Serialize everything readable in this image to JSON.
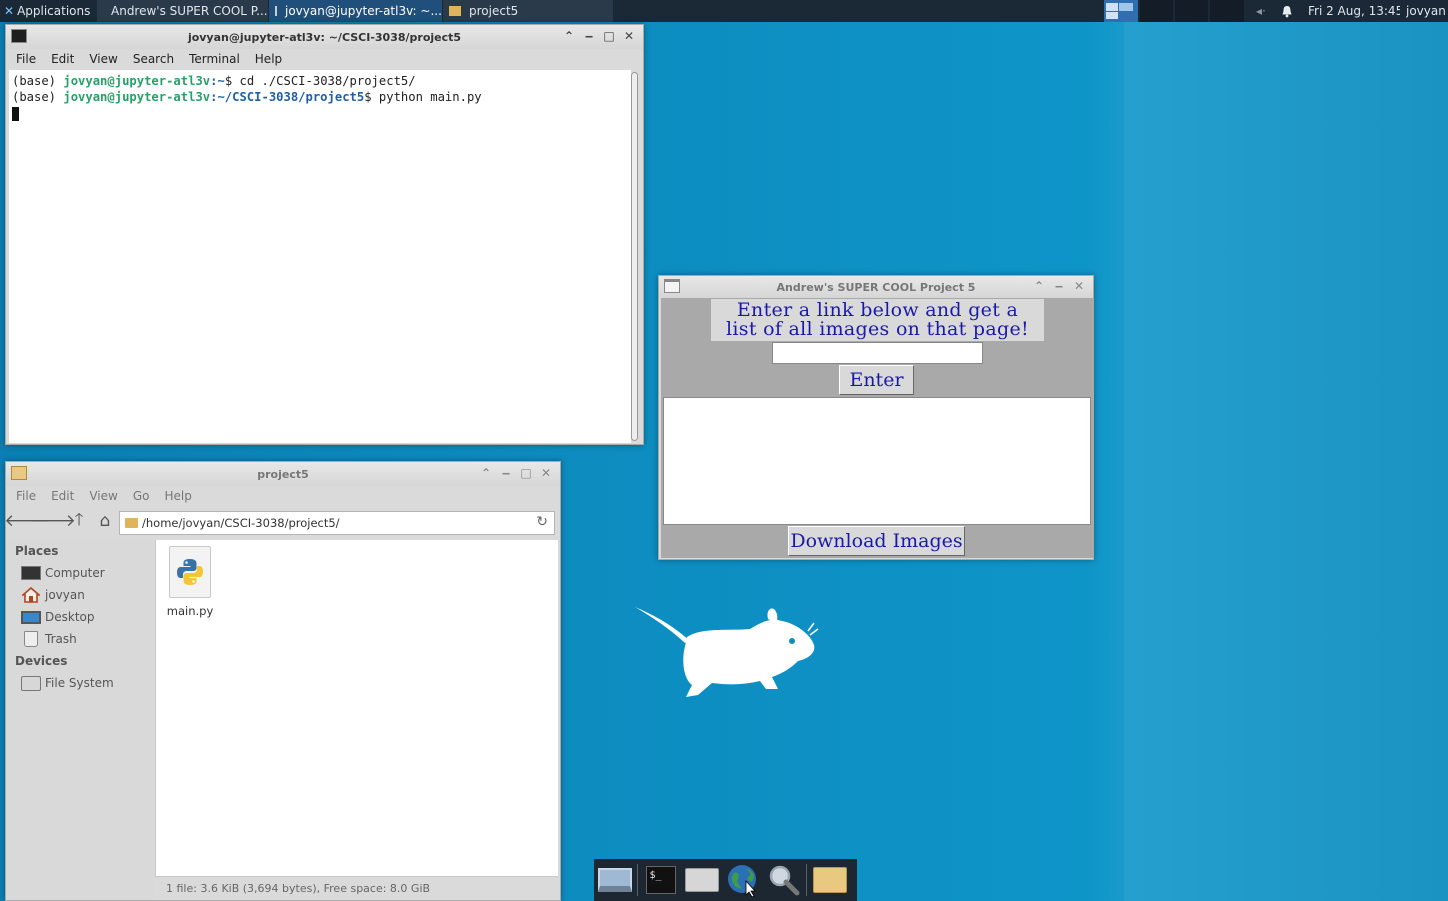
{
  "panel": {
    "apps_label": "Applications",
    "tasks": [
      {
        "label": "Andrew's SUPER COOL P...",
        "icon": "window-icon"
      },
      {
        "label": "jovyan@jupyter-atl3v: ~...",
        "icon": "terminal-icon"
      },
      {
        "label": "project5",
        "icon": "folder-icon"
      }
    ],
    "clock": "Fri  2 Aug, 13:45",
    "user": "jovyan"
  },
  "terminal": {
    "title": "jovyan@jupyter-atl3v: ~/CSCI-3038/project5",
    "menu": [
      "File",
      "Edit",
      "View",
      "Search",
      "Terminal",
      "Help"
    ],
    "lines": [
      {
        "prefix": "(base) ",
        "user": "jovyan@jupyter-atl3v",
        "path": ":~",
        "cmd": "$ cd ./CSCI-3038/project5/"
      },
      {
        "prefix": "(base) ",
        "user": "jovyan@jupyter-atl3v",
        "path": ":~/CSCI-3038/project5",
        "cmd": "$ python main.py"
      }
    ]
  },
  "filemanager": {
    "title": "project5",
    "menu": [
      "File",
      "Edit",
      "View",
      "Go",
      "Help"
    ],
    "path": "/home/jovyan/CSCI-3038/project5/",
    "places_header": "Places",
    "places": [
      {
        "label": "Computer",
        "icon": "computer-icon"
      },
      {
        "label": "jovyan",
        "icon": "home-icon"
      },
      {
        "label": "Desktop",
        "icon": "desktop-icon"
      },
      {
        "label": "Trash",
        "icon": "trash-icon"
      }
    ],
    "devices_header": "Devices",
    "devices": [
      {
        "label": "File System",
        "icon": "drive-icon"
      }
    ],
    "files": [
      {
        "name": "main.py",
        "icon": "python-file-icon"
      }
    ],
    "status": "1 file: 3.6 KiB (3,694 bytes), Free space: 8.0 GiB"
  },
  "app": {
    "title": "Andrew's SUPER COOL Project 5",
    "prompt_line1": "Enter a link below and get a",
    "prompt_line2": "list of all images on that page!",
    "url_value": "",
    "enter_label": "Enter",
    "download_label": "Download Images"
  },
  "dock": {
    "items": [
      "show-desktop-icon",
      "terminal-icon",
      "home-folder-icon",
      "web-browser-icon",
      "search-icon",
      "folder-icon"
    ]
  },
  "colors": {
    "desktop": "#0e8dbf",
    "panel": "#1b2836",
    "app_text": "#1a1aa8",
    "app_bg": "#a9a9a9"
  }
}
